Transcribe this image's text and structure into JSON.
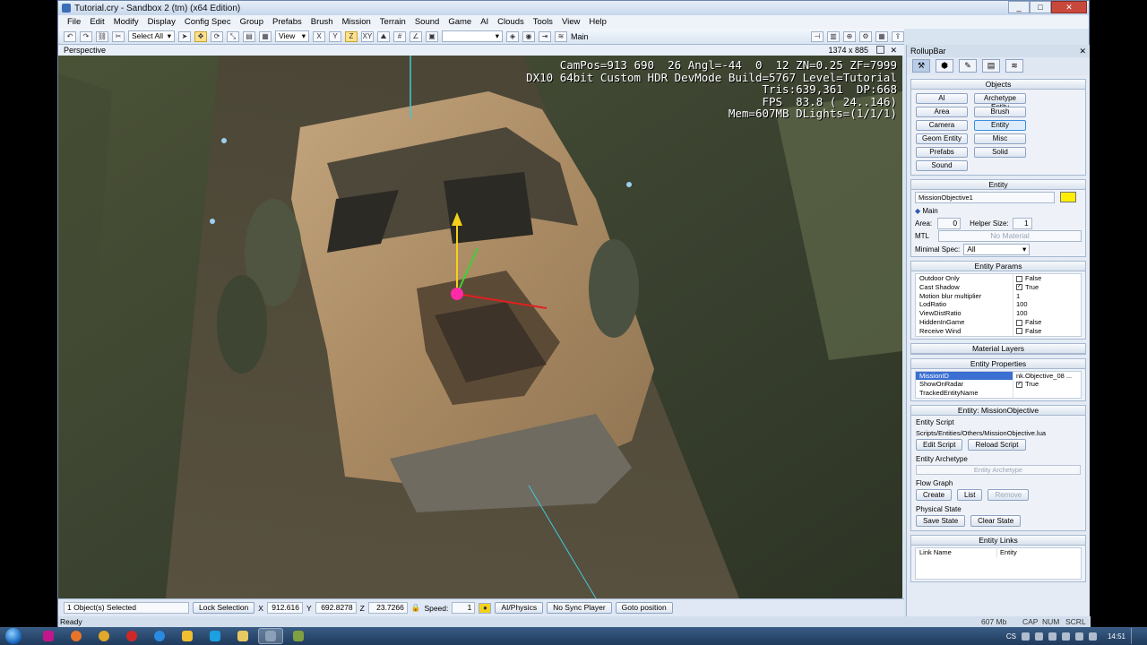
{
  "window": {
    "title": "Tutorial.cry - Sandbox 2 (tm) (x64 Edition)",
    "controls": [
      "_",
      "□",
      "✕"
    ]
  },
  "menu": [
    "File",
    "Edit",
    "Modify",
    "Display",
    "Config Spec",
    "Group",
    "Prefabs",
    "Brush",
    "Mission",
    "Terrain",
    "Sound",
    "Game",
    "AI",
    "Clouds",
    "Tools",
    "View",
    "Help"
  ],
  "toolbar": {
    "select_filter": "Select All",
    "ref_coord": "View",
    "axes": [
      "X",
      "Y",
      "Z",
      "XY"
    ],
    "layer": "Main"
  },
  "viewport": {
    "label": "Perspective",
    "resolution": "1374 x 885",
    "hud": [
      "CamPos=913 690  26 Angl=-44  0  12 ZN=0.25 ZF=7999",
      "DX10 64bit Custom HDR DevMode Build=5767 Level=Tutorial",
      "Tris:639,361  DP:668",
      "FPS  83.8 ( 24..146)",
      "Mem=607MB DLights=(1/1/1)"
    ]
  },
  "statusbar": {
    "selection": "1 Object(s) Selected",
    "lock_selection": "Lock Selection",
    "x_label": "X",
    "x": "912.616",
    "y_label": "Y",
    "y": "692.8278",
    "z_label": "Z",
    "z": "23.7266",
    "speed_label": "Speed:",
    "speed": "1",
    "ai_physics": "AI/Physics",
    "no_sync": "No Sync Player",
    "goto": "Goto position",
    "ready": "Ready",
    "memory": "607 Mb",
    "cap": "CAP",
    "num": "NUM",
    "scrl": "SCRL"
  },
  "rollup": {
    "title": "RollupBar",
    "objects": {
      "title": "Objects",
      "buttons": [
        "AI",
        "Archetype Entity",
        "Area",
        "Brush",
        "Camera",
        "Entity",
        "Geom Entity",
        "Misc",
        "Prefabs",
        "Solid",
        "Sound"
      ],
      "selected": "Entity"
    },
    "entity": {
      "title": "Entity",
      "name": "MissionObjective1",
      "color": "#ffee00",
      "layer": "Main",
      "area_label": "Area:",
      "area": "0",
      "helper_label": "Helper Size:",
      "helper": "1",
      "mtl_label": "MTL",
      "mtl": "No Material",
      "minspec_label": "Minimal Spec:",
      "minspec": "All"
    },
    "entity_params": {
      "title": "Entity Params",
      "rows": [
        {
          "k": "Outdoor Only",
          "v": "False",
          "check": ""
        },
        {
          "k": "Cast Shadow",
          "v": "True",
          "check": "✓"
        },
        {
          "k": "Motion blur multiplier",
          "v": "1",
          "check": ""
        },
        {
          "k": "LodRatio",
          "v": "100",
          "check": ""
        },
        {
          "k": "ViewDistRatio",
          "v": "100",
          "check": ""
        },
        {
          "k": "HiddenInGame",
          "v": "False",
          "check": ""
        },
        {
          "k": "Receive Wind",
          "v": "False",
          "check": ""
        }
      ]
    },
    "material_layers": {
      "title": "Material Layers"
    },
    "entity_properties": {
      "title": "Entity Properties",
      "rows": [
        {
          "k": "MissionID",
          "v": "nk.Objective_08 ...",
          "check": ""
        },
        {
          "k": "ShowOnRadar",
          "v": "True",
          "check": "✓"
        },
        {
          "k": "TrackedEntityName",
          "v": "",
          "check": ""
        }
      ]
    },
    "mission_objective": {
      "title": "Entity: MissionObjective",
      "script_label": "Entity Script",
      "script_path": "Scripts/Entities/Others/MissionObjective.lua",
      "edit_script": "Edit Script",
      "reload_script": "Reload Script",
      "archetype_label": "Entity Archetype",
      "archetype": "Entity Archetype",
      "flowgraph_label": "Flow Graph",
      "create": "Create",
      "list": "List",
      "remove": "Remove",
      "physical_label": "Physical State",
      "save_state": "Save State",
      "clear_state": "Clear State"
    },
    "entity_links": {
      "title": "Entity Links",
      "col1": "Link Name",
      "col2": "Entity"
    }
  },
  "taskbar": {
    "lang": "CS",
    "time": "14:51"
  },
  "colors": {
    "accent": "#3b6fd1",
    "selected_entity": "#ff3fb0",
    "hud_text": "#ffffff"
  }
}
